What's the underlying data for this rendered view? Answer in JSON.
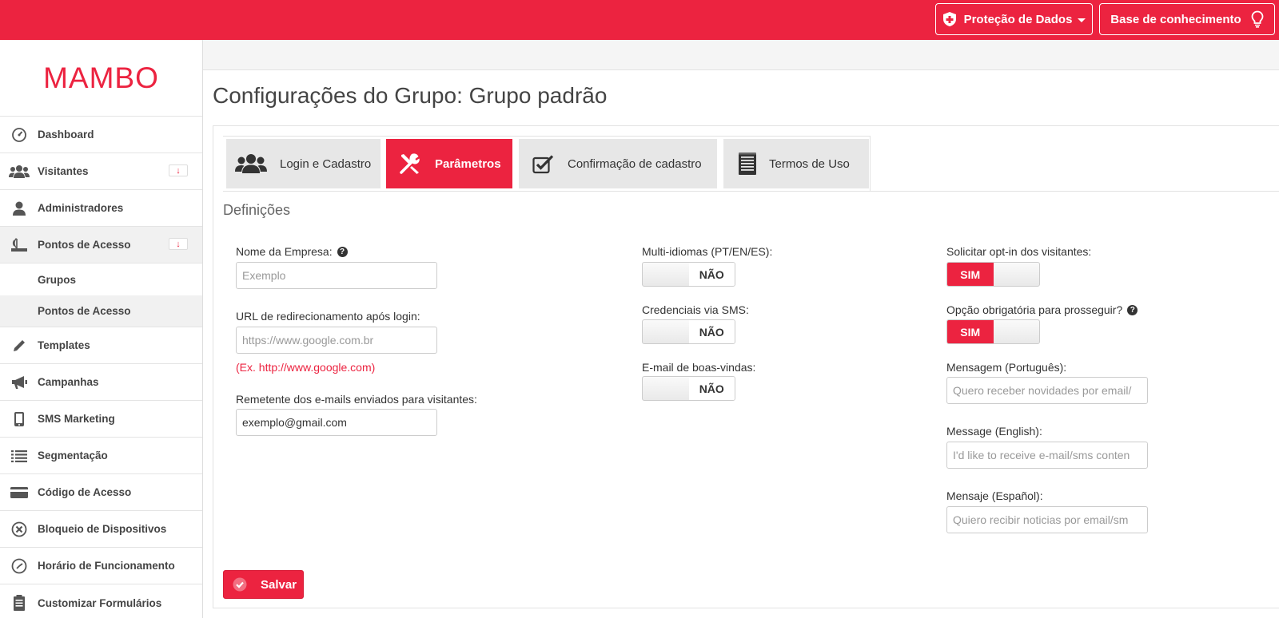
{
  "topbar": {
    "data_protection": "Proteção de Dados",
    "knowledge_base": "Base de conhecimento"
  },
  "sidebar": {
    "logo": "MAMBO",
    "items": [
      {
        "label": "Dashboard",
        "icon": "dashboard-icon"
      },
      {
        "label": "Visitantes",
        "icon": "users-icon",
        "badge": "↓"
      },
      {
        "label": "Administradores",
        "icon": "user-icon"
      },
      {
        "label": "Pontos de Acesso",
        "icon": "router-icon",
        "badge": "↓"
      },
      {
        "label": "Templates",
        "icon": "pencil-icon"
      },
      {
        "label": "Campanhas",
        "icon": "megaphone-icon"
      },
      {
        "label": "SMS Marketing",
        "icon": "phone-icon"
      },
      {
        "label": "Segmentação",
        "icon": "list-icon"
      },
      {
        "label": "Código de Acesso",
        "icon": "card-icon"
      },
      {
        "label": "Bloqueio de Dispositivos",
        "icon": "block-icon"
      },
      {
        "label": "Horário de Funcionamento",
        "icon": "clock-icon"
      },
      {
        "label": "Customizar Formulários",
        "icon": "clipboard-icon"
      }
    ],
    "subitems": [
      "Grupos",
      "Pontos de Acesso"
    ]
  },
  "page": {
    "title": "Configurações do Grupo: Grupo padrão",
    "section": "Definições",
    "save": "Salvar"
  },
  "tabs": [
    {
      "label": "Login e Cadastro"
    },
    {
      "label": "Parâmetros"
    },
    {
      "label": "Confirmação de cadastro"
    },
    {
      "label": "Termos de Uso"
    }
  ],
  "form": {
    "company_label": "Nome da Empresa:",
    "company_placeholder": "Exemplo",
    "url_label": "URL de redirecionamento após login:",
    "url_placeholder": "https://www.google.com.br",
    "url_hint": "(Ex. http://www.google.com)",
    "sender_label": "Remetente dos e-mails enviados para visitantes:",
    "sender_value": "exemplo@gmail.com",
    "multilang_label": "Multi-idiomas (PT/EN/ES):",
    "multilang_state": "NÃO",
    "sms_label": "Credenciais via SMS:",
    "sms_state": "NÃO",
    "welcome_label": "E-mail de boas-vindas:",
    "welcome_state": "NÃO",
    "optin_label": "Solicitar opt-in dos visitantes:",
    "optin_state": "SIM",
    "mandatory_label": "Opção obrigatória para prosseguir?",
    "mandatory_state": "SIM",
    "msg_pt_label": "Mensagem (Português):",
    "msg_pt_placeholder": "Quero receber novidades por email/",
    "msg_en_label": "Message (English):",
    "msg_en_placeholder": "I'd like to receive e-mail/sms conten",
    "msg_es_label": "Mensaje (Español):",
    "msg_es_placeholder": "Quiero recibir noticias por email/sm"
  },
  "colors": {
    "accent": "#ec2340"
  }
}
